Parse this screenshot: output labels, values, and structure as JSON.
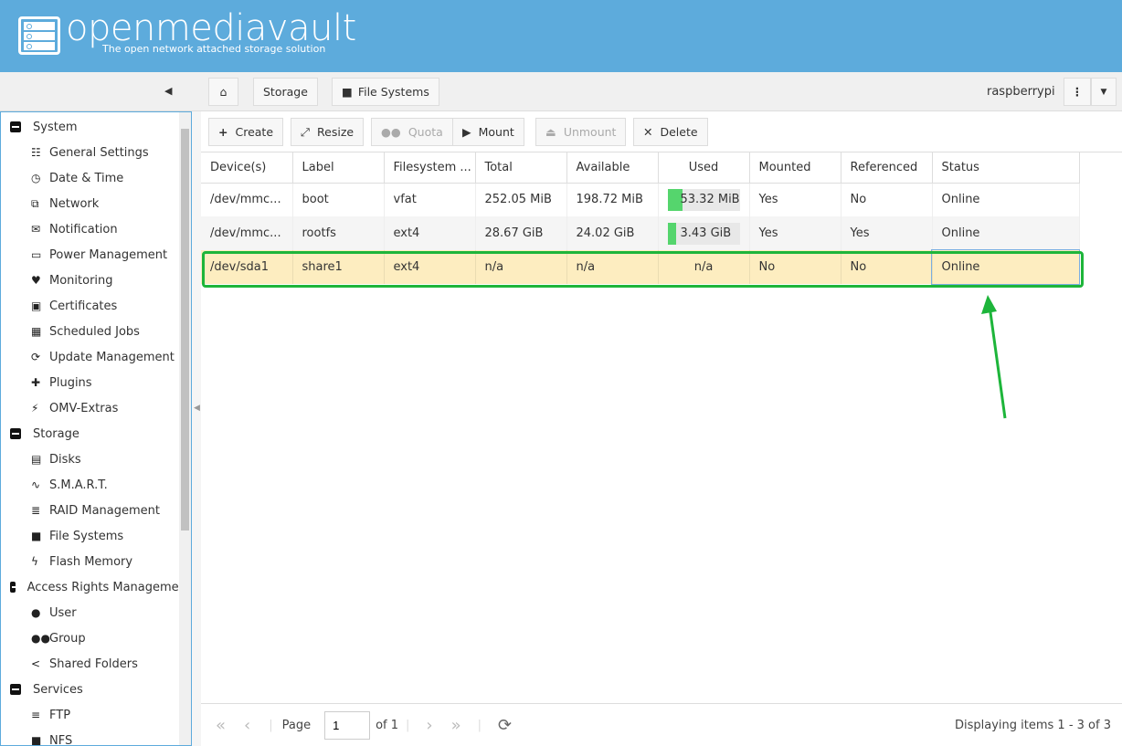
{
  "header": {
    "logo": "openmediavault",
    "tagline": "The open network attached storage solution"
  },
  "breadcrumb": {
    "storage": "Storage",
    "filesystems": "File Systems",
    "host": "raspberrypi"
  },
  "sidebar": [
    {
      "label": "System",
      "top": true
    },
    {
      "label": "General Settings",
      "icon": "☷"
    },
    {
      "label": "Date & Time",
      "icon": "◷"
    },
    {
      "label": "Network",
      "icon": "⧉"
    },
    {
      "label": "Notification",
      "icon": "✉"
    },
    {
      "label": "Power Management",
      "icon": "▭"
    },
    {
      "label": "Monitoring",
      "icon": "♥"
    },
    {
      "label": "Certificates",
      "icon": "▣"
    },
    {
      "label": "Scheduled Jobs",
      "icon": "▦"
    },
    {
      "label": "Update Management",
      "icon": "⟳"
    },
    {
      "label": "Plugins",
      "icon": "✚"
    },
    {
      "label": "OMV-Extras",
      "icon": "⚡"
    },
    {
      "label": "Storage",
      "top": true
    },
    {
      "label": "Disks",
      "icon": "▤"
    },
    {
      "label": "S.M.A.R.T.",
      "icon": "∿"
    },
    {
      "label": "RAID Management",
      "icon": "≣"
    },
    {
      "label": "File Systems",
      "icon": "■"
    },
    {
      "label": "Flash Memory",
      "icon": "ϟ"
    },
    {
      "label": "Access Rights Management",
      "top": true
    },
    {
      "label": "User",
      "icon": "●"
    },
    {
      "label": "Group",
      "icon": "●●"
    },
    {
      "label": "Shared Folders",
      "icon": "<"
    },
    {
      "label": "Services",
      "top": true
    },
    {
      "label": "FTP",
      "icon": "≡"
    },
    {
      "label": "NFS",
      "icon": "■"
    }
  ],
  "toolbar": {
    "create": "Create",
    "resize": "Resize",
    "quota": "Quota",
    "mount": "Mount",
    "unmount": "Unmount",
    "delete": "Delete"
  },
  "grid": {
    "columns": [
      "Device(s)",
      "Label",
      "Filesystem ...",
      "Total",
      "Available",
      "Used",
      "Mounted",
      "Referenced",
      "Status"
    ],
    "rows": [
      {
        "device": "/dev/mmc...",
        "label": "boot",
        "fs": "vfat",
        "total": "252.05 MiB",
        "available": "198.72 MiB",
        "used": "53.32 MiB",
        "used_pct": 21,
        "mounted": "Yes",
        "referenced": "No",
        "status": "Online"
      },
      {
        "device": "/dev/mmc...",
        "label": "rootfs",
        "fs": "ext4",
        "total": "28.67 GiB",
        "available": "24.02 GiB",
        "used": "3.43 GiB",
        "used_pct": 12,
        "mounted": "Yes",
        "referenced": "Yes",
        "status": "Online"
      },
      {
        "device": "/dev/sda1",
        "label": "share1",
        "fs": "ext4",
        "total": "n/a",
        "available": "n/a",
        "used": "n/a",
        "mounted": "No",
        "referenced": "No",
        "status": "Online"
      }
    ]
  },
  "pager": {
    "page_label": "Page",
    "page": "1",
    "of": "of 1",
    "display": "Displaying items 1 - 3 of 3"
  }
}
